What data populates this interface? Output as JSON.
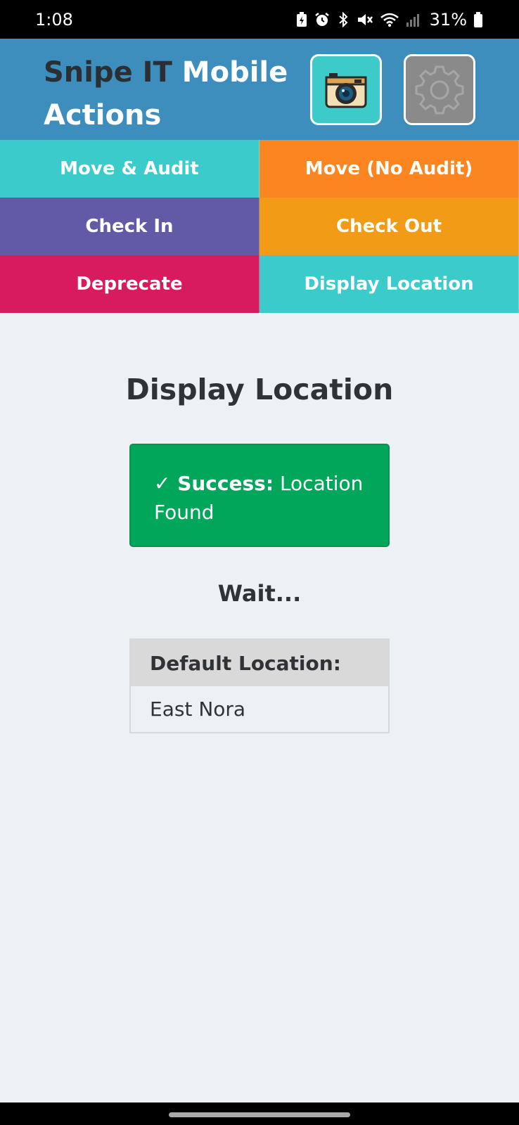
{
  "status_bar": {
    "time": "1:08",
    "battery_percent": "31%"
  },
  "header": {
    "title_part1": "Snipe IT",
    "title_part2": "Mobile Actions",
    "camera_button_icon": "camera-icon",
    "settings_button_icon": "gear-icon"
  },
  "actions": [
    {
      "label": "Move & Audit",
      "color": "#3ccbcb"
    },
    {
      "label": "Move (No Audit)",
      "color": "#fb8621"
    },
    {
      "label": "Check In",
      "color": "#625aa7"
    },
    {
      "label": "Check Out",
      "color": "#f29b16"
    },
    {
      "label": "Deprecate",
      "color": "#d81a5f"
    },
    {
      "label": "Display Location",
      "color": "#3ccbcb"
    }
  ],
  "main": {
    "title": "Display Location",
    "success_prefix": "✓ Success:",
    "success_message": "Location Found",
    "wait_text": "Wait...",
    "table_header": "Default Location:",
    "table_value": "East Nora"
  }
}
